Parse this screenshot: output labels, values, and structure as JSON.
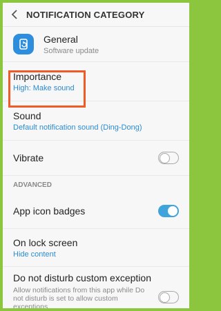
{
  "appbar": {
    "title": "NOTIFICATION CATEGORY"
  },
  "app": {
    "name": "General",
    "subtitle": "Software update"
  },
  "importance": {
    "title": "Importance",
    "value": "High: Make sound"
  },
  "sound": {
    "title": "Sound",
    "value": "Default notification sound (Ding-Dong)"
  },
  "vibrate": {
    "title": "Vibrate",
    "enabled": false
  },
  "advanced": {
    "header": "ADVANCED"
  },
  "badges": {
    "title": "App icon badges",
    "enabled": true
  },
  "lockscreen": {
    "title": "On lock screen",
    "value": "Hide content"
  },
  "dnd": {
    "title": "Do not disturb custom exception",
    "description": "Allow notifications from this app while Do not disturb is set to allow custom exceptions.",
    "enabled": false
  },
  "colors": {
    "accent": "#2a8bd1",
    "toggle_on": "#3fa3dc",
    "highlight": "#f05a28",
    "frame": "#8cc63f"
  }
}
